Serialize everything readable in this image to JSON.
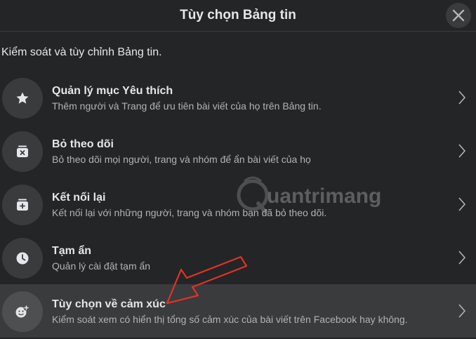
{
  "header": {
    "title": "Tùy chọn Bảng tin",
    "close_icon": "close-icon"
  },
  "subtitle": "Kiểm soát và tùy chỉnh Bảng tin.",
  "items": [
    {
      "title": "Quản lý mục Yêu thích",
      "description": "Thêm người và Trang để ưu tiên bài viết của họ trên Bảng tin.",
      "icon": "star-icon"
    },
    {
      "title": "Bỏ theo dõi",
      "description": "Bỏ theo dõi mọi người, trang và nhóm để ẩn bài viết của họ",
      "icon": "unfollow-icon"
    },
    {
      "title": "Kết nối lại",
      "description": "Kết nối lại với những người, trang và nhóm bạn đã bỏ theo dõi.",
      "icon": "reconnect-icon"
    },
    {
      "title": "Tạm ẩn",
      "description": "Quản lý cài đặt tạm ẩn",
      "icon": "clock-icon"
    },
    {
      "title": "Tùy chọn về cảm xúc",
      "description": "Kiểm soát xem có hiển thị tổng số cảm xúc của bài viết trên Facebook hay không.",
      "icon": "reaction-icon",
      "highlighted": true
    }
  ],
  "watermark": {
    "text": "uantrimang"
  },
  "colors": {
    "background": "#242526",
    "icon_circle": "#3a3b3c",
    "highlight_row": "#3a3b3c",
    "annotation_arrow": "#e0322a"
  }
}
